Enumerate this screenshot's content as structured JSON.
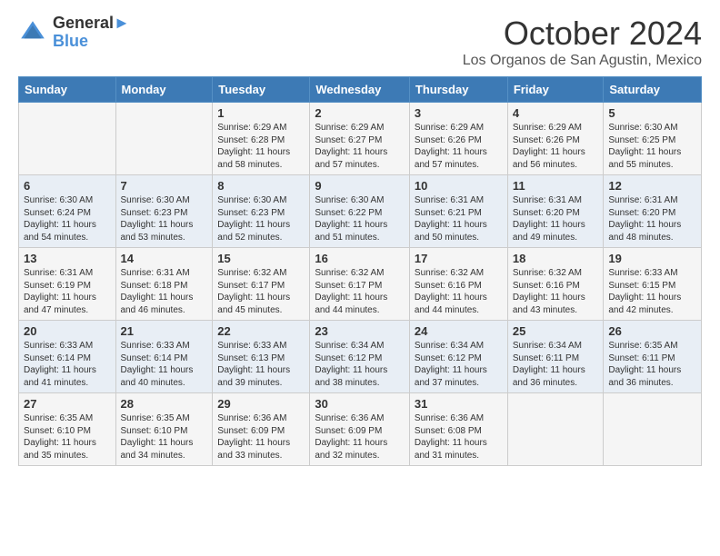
{
  "header": {
    "logo_line1": "General",
    "logo_line2": "Blue",
    "month": "October 2024",
    "location": "Los Organos de San Agustin, Mexico"
  },
  "weekdays": [
    "Sunday",
    "Monday",
    "Tuesday",
    "Wednesday",
    "Thursday",
    "Friday",
    "Saturday"
  ],
  "weeks": [
    [
      {
        "day": "",
        "info": ""
      },
      {
        "day": "",
        "info": ""
      },
      {
        "day": "1",
        "info": "Sunrise: 6:29 AM\nSunset: 6:28 PM\nDaylight: 11 hours and 58 minutes."
      },
      {
        "day": "2",
        "info": "Sunrise: 6:29 AM\nSunset: 6:27 PM\nDaylight: 11 hours and 57 minutes."
      },
      {
        "day": "3",
        "info": "Sunrise: 6:29 AM\nSunset: 6:26 PM\nDaylight: 11 hours and 57 minutes."
      },
      {
        "day": "4",
        "info": "Sunrise: 6:29 AM\nSunset: 6:26 PM\nDaylight: 11 hours and 56 minutes."
      },
      {
        "day": "5",
        "info": "Sunrise: 6:30 AM\nSunset: 6:25 PM\nDaylight: 11 hours and 55 minutes."
      }
    ],
    [
      {
        "day": "6",
        "info": "Sunrise: 6:30 AM\nSunset: 6:24 PM\nDaylight: 11 hours and 54 minutes."
      },
      {
        "day": "7",
        "info": "Sunrise: 6:30 AM\nSunset: 6:23 PM\nDaylight: 11 hours and 53 minutes."
      },
      {
        "day": "8",
        "info": "Sunrise: 6:30 AM\nSunset: 6:23 PM\nDaylight: 11 hours and 52 minutes."
      },
      {
        "day": "9",
        "info": "Sunrise: 6:30 AM\nSunset: 6:22 PM\nDaylight: 11 hours and 51 minutes."
      },
      {
        "day": "10",
        "info": "Sunrise: 6:31 AM\nSunset: 6:21 PM\nDaylight: 11 hours and 50 minutes."
      },
      {
        "day": "11",
        "info": "Sunrise: 6:31 AM\nSunset: 6:20 PM\nDaylight: 11 hours and 49 minutes."
      },
      {
        "day": "12",
        "info": "Sunrise: 6:31 AM\nSunset: 6:20 PM\nDaylight: 11 hours and 48 minutes."
      }
    ],
    [
      {
        "day": "13",
        "info": "Sunrise: 6:31 AM\nSunset: 6:19 PM\nDaylight: 11 hours and 47 minutes."
      },
      {
        "day": "14",
        "info": "Sunrise: 6:31 AM\nSunset: 6:18 PM\nDaylight: 11 hours and 46 minutes."
      },
      {
        "day": "15",
        "info": "Sunrise: 6:32 AM\nSunset: 6:17 PM\nDaylight: 11 hours and 45 minutes."
      },
      {
        "day": "16",
        "info": "Sunrise: 6:32 AM\nSunset: 6:17 PM\nDaylight: 11 hours and 44 minutes."
      },
      {
        "day": "17",
        "info": "Sunrise: 6:32 AM\nSunset: 6:16 PM\nDaylight: 11 hours and 44 minutes."
      },
      {
        "day": "18",
        "info": "Sunrise: 6:32 AM\nSunset: 6:16 PM\nDaylight: 11 hours and 43 minutes."
      },
      {
        "day": "19",
        "info": "Sunrise: 6:33 AM\nSunset: 6:15 PM\nDaylight: 11 hours and 42 minutes."
      }
    ],
    [
      {
        "day": "20",
        "info": "Sunrise: 6:33 AM\nSunset: 6:14 PM\nDaylight: 11 hours and 41 minutes."
      },
      {
        "day": "21",
        "info": "Sunrise: 6:33 AM\nSunset: 6:14 PM\nDaylight: 11 hours and 40 minutes."
      },
      {
        "day": "22",
        "info": "Sunrise: 6:33 AM\nSunset: 6:13 PM\nDaylight: 11 hours and 39 minutes."
      },
      {
        "day": "23",
        "info": "Sunrise: 6:34 AM\nSunset: 6:12 PM\nDaylight: 11 hours and 38 minutes."
      },
      {
        "day": "24",
        "info": "Sunrise: 6:34 AM\nSunset: 6:12 PM\nDaylight: 11 hours and 37 minutes."
      },
      {
        "day": "25",
        "info": "Sunrise: 6:34 AM\nSunset: 6:11 PM\nDaylight: 11 hours and 36 minutes."
      },
      {
        "day": "26",
        "info": "Sunrise: 6:35 AM\nSunset: 6:11 PM\nDaylight: 11 hours and 36 minutes."
      }
    ],
    [
      {
        "day": "27",
        "info": "Sunrise: 6:35 AM\nSunset: 6:10 PM\nDaylight: 11 hours and 35 minutes."
      },
      {
        "day": "28",
        "info": "Sunrise: 6:35 AM\nSunset: 6:10 PM\nDaylight: 11 hours and 34 minutes."
      },
      {
        "day": "29",
        "info": "Sunrise: 6:36 AM\nSunset: 6:09 PM\nDaylight: 11 hours and 33 minutes."
      },
      {
        "day": "30",
        "info": "Sunrise: 6:36 AM\nSunset: 6:09 PM\nDaylight: 11 hours and 32 minutes."
      },
      {
        "day": "31",
        "info": "Sunrise: 6:36 AM\nSunset: 6:08 PM\nDaylight: 11 hours and 31 minutes."
      },
      {
        "day": "",
        "info": ""
      },
      {
        "day": "",
        "info": ""
      }
    ]
  ]
}
